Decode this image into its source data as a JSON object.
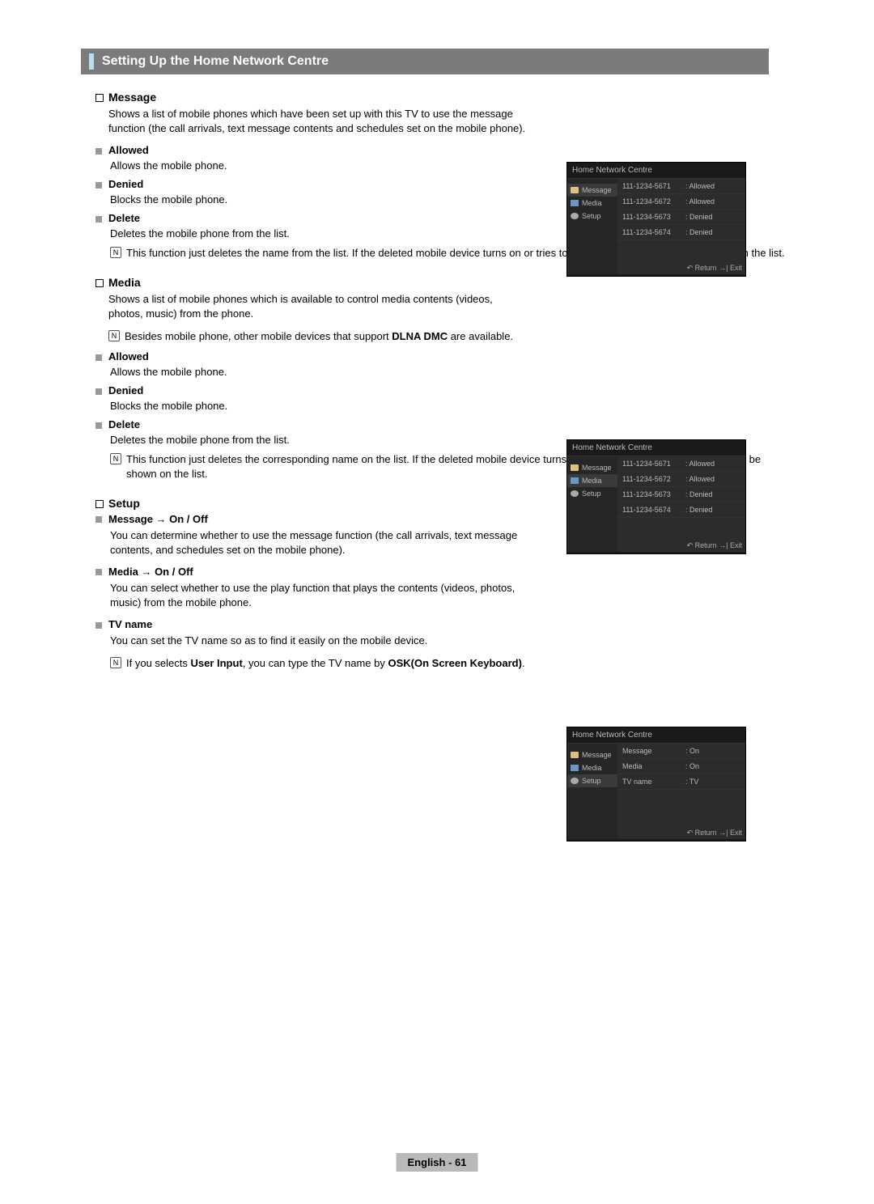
{
  "title": "Setting Up the Home Network Centre",
  "sections": {
    "message": {
      "heading": "Message",
      "desc": "Shows a list of mobile phones which have been set up with this TV to use the message function (the call arrivals, text message contents and schedules set on the mobile phone).",
      "allowed_label": "Allowed",
      "allowed_desc": "Allows the mobile phone.",
      "denied_label": "Denied",
      "denied_desc": "Blocks the mobile phone.",
      "delete_label": "Delete",
      "delete_desc": "Deletes the mobile phone from the list.",
      "delete_note": "This function just deletes the name from the list. If the deleted mobile device turns on or tries to connect to the TV, it may be shown on the list."
    },
    "media": {
      "heading": "Media",
      "desc": "Shows a list of mobile phones which is available to control media contents (videos, photos, music) from the phone.",
      "note_pre": "Besides mobile phone, other mobile devices that support ",
      "note_strong": "DLNA DMC",
      "note_post": " are available.",
      "allowed_label": "Allowed",
      "allowed_desc": "Allows the mobile phone.",
      "denied_label": "Denied",
      "denied_desc": "Blocks the mobile phone.",
      "delete_label": "Delete",
      "delete_desc": "Deletes the mobile phone from the list.",
      "delete_note": "This function just deletes the corresponding name on the list. If the deleted mobile device turns on or tries to connect to the TV, it may be shown on the list."
    },
    "setup": {
      "heading": "Setup",
      "msg_label": "Message → On / Off",
      "msg_desc": "You can determine whether to use the message function (the call arrivals, text message contents, and schedules set on the mobile phone).",
      "media_label": "Media → On / Off",
      "media_desc": "You can select whether to use the play function that plays the contents (videos, photos, music) from the mobile phone.",
      "tvname_label": "TV name",
      "tvname_desc": "You can set the TV name so as to find it easily on the mobile device.",
      "tvname_note_pre": "If you selects ",
      "tvname_note_s1": "User Input",
      "tvname_note_mid": ", you can type the TV name by ",
      "tvname_note_s2": "OSK(On Screen Keyboard)",
      "tvname_note_post": "."
    }
  },
  "screenshots": {
    "title": "Home Network Centre",
    "sidebar": {
      "message": "Message",
      "media": "Media",
      "setup": "Setup"
    },
    "list": [
      {
        "num": "111-1234-5671",
        "status": ": Allowed"
      },
      {
        "num": "111-1234-5672",
        "status": ": Allowed"
      },
      {
        "num": "111-1234-5673",
        "status": ": Denied"
      },
      {
        "num": "111-1234-5674",
        "status": ": Denied"
      }
    ],
    "setup_rows": [
      {
        "k": "Message",
        "v": ": On"
      },
      {
        "k": "Media",
        "v": ": On"
      },
      {
        "k": "TV name",
        "v": ": TV"
      }
    ],
    "footer_return": "Return",
    "footer_exit": "Exit"
  },
  "footer": "English - 61"
}
